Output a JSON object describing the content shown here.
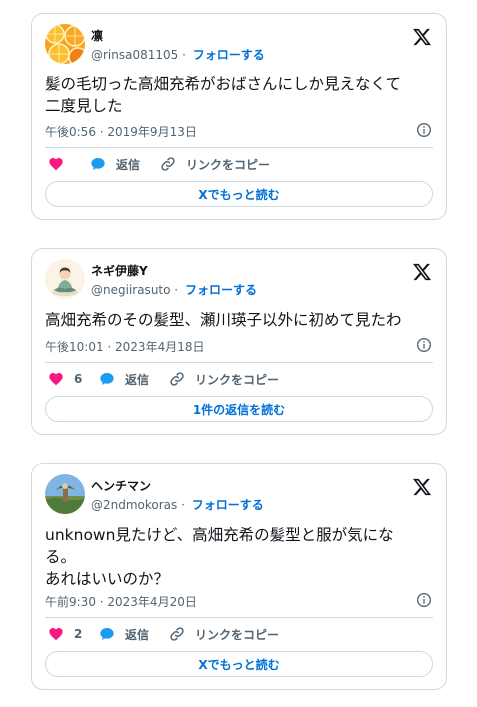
{
  "tweets": [
    {
      "name": "凛",
      "handle": "@rinsa081105",
      "separator": "·",
      "follow_label": "フォローする",
      "text": "髪の毛切った高畑充希がおばさんにしか見えなくて\n二度見した",
      "timestamp": "午後0:56 · 2019年9月13日",
      "like_count": "",
      "reply_label": "返信",
      "copy_link_label": "リンクをコピー",
      "read_more_label": "Xでもっと読む",
      "avatar_icon": "orange-slices-avatar"
    },
    {
      "name": "ネギ伊藤Y",
      "handle": "@negiirasuto",
      "separator": "·",
      "follow_label": "フォローする",
      "text": "高畑充希のその髪型、瀬川瑛子以外に初めて見たわ",
      "timestamp": "午後10:01 · 2023年4月18日",
      "like_count": "6",
      "reply_label": "返信",
      "copy_link_label": "リンクをコピー",
      "read_more_label": "1件の返信を読む",
      "avatar_icon": "illustrated-person-avatar"
    },
    {
      "name": "ヘンチマン",
      "handle": "@2ndmokoras",
      "separator": "·",
      "follow_label": "フォローする",
      "text": "unknown見たけど、高畑充希の髪型と服が気にな\nる。\nあれはいいのか？",
      "timestamp": "午前9:30 · 2023年4月20日",
      "like_count": "2",
      "reply_label": "返信",
      "copy_link_label": "リンクをコピー",
      "read_more_label": "Xでもっと読む",
      "avatar_icon": "landscape-photo-avatar"
    }
  ],
  "colors": {
    "like": "#f91880",
    "reply": "#1d9bf0",
    "link": "#006fd6",
    "secondary_text": "#536471",
    "border": "#cfd9de"
  }
}
